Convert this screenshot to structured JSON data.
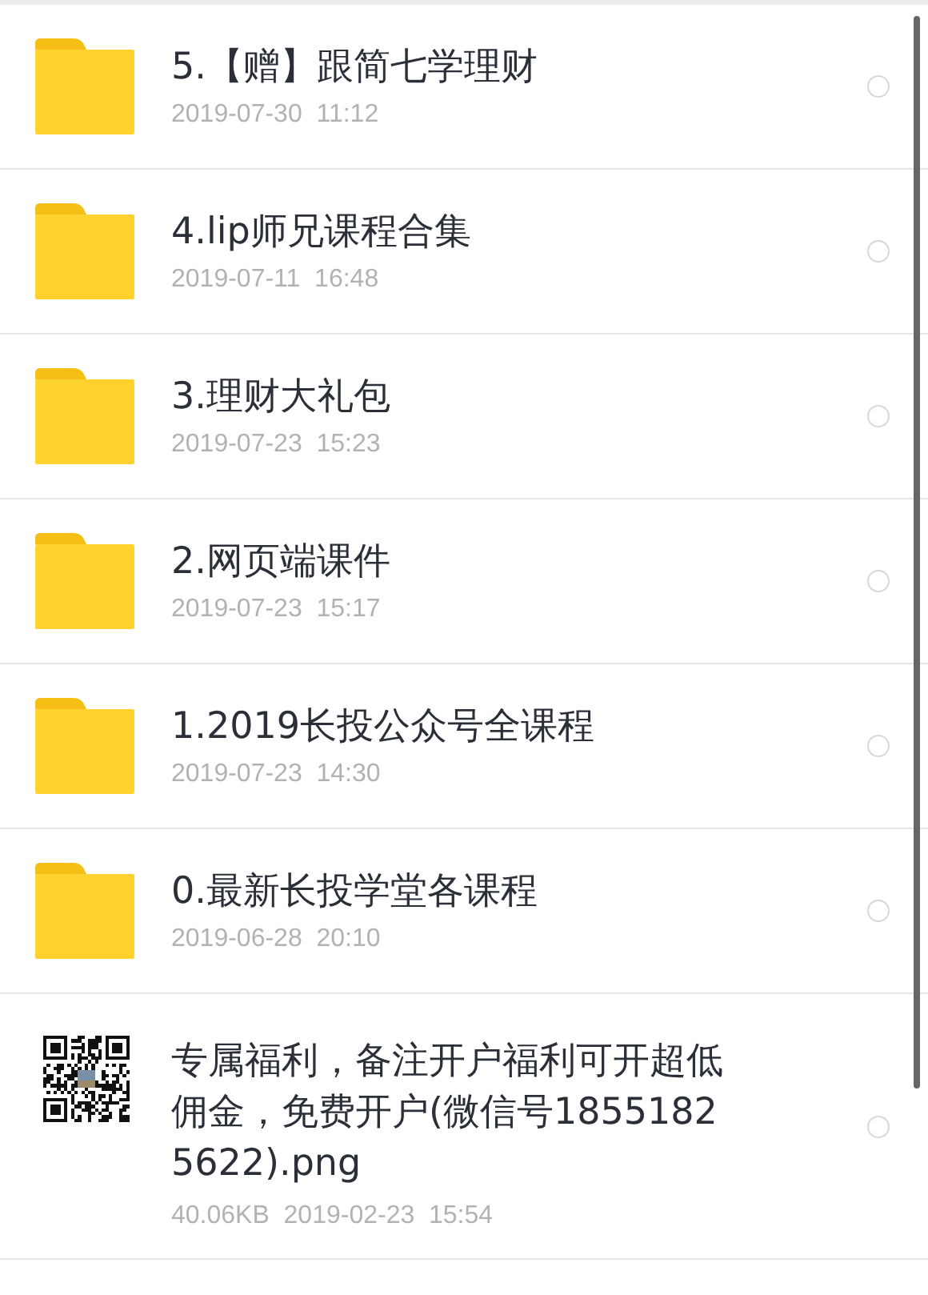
{
  "items": [
    {
      "kind": "folder",
      "name": "5.【赠】跟简七学理财",
      "meta": "2019-07-30  11:12",
      "selected": false
    },
    {
      "kind": "folder",
      "name": "4.lip师兄课程合集",
      "meta": "2019-07-11  16:48",
      "selected": false
    },
    {
      "kind": "folder",
      "name": "3.理财大礼包",
      "meta": "2019-07-23  15:23",
      "selected": false
    },
    {
      "kind": "folder",
      "name": "2.网页端课件",
      "meta": "2019-07-23  15:17",
      "selected": false
    },
    {
      "kind": "folder",
      "name": "1.2019长投公众号全课程",
      "meta": "2019-07-23  14:30",
      "selected": false
    },
    {
      "kind": "folder",
      "name": "0.最新长投学堂各课程",
      "meta": "2019-06-28  20:10",
      "selected": false
    },
    {
      "kind": "image",
      "name": "专属福利，备注开户福利可开超低佣金，免费开户(微信号18551825622).png",
      "meta": "40.06KB  2019-02-23  15:54",
      "selected": false
    }
  ]
}
